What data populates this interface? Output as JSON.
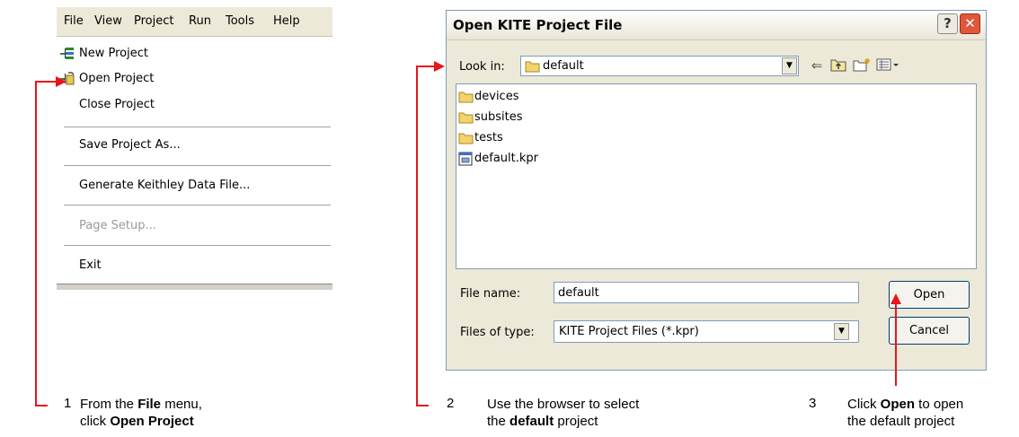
{
  "menu": {
    "menubar": [
      "File",
      "View",
      "Project",
      "Run",
      "Tools",
      "Help"
    ],
    "items": [
      {
        "label": "New Project",
        "icon": "new-project-icon"
      },
      {
        "label": "Open Project",
        "icon": "open-project-icon"
      },
      {
        "label": "Close Project"
      },
      {
        "label": "Save Project As..."
      },
      {
        "label": "Generate Keithley Data File..."
      },
      {
        "label": "Page Setup...",
        "disabled": true
      },
      {
        "label": "Exit"
      }
    ]
  },
  "dialog": {
    "title": "Open KITE Project File",
    "help_button": "?",
    "close_button": "✕",
    "look_in_label": "Look in:",
    "look_in_value": "default",
    "files": [
      {
        "name": "devices",
        "icon": "folder-icon"
      },
      {
        "name": "subsites",
        "icon": "folder-icon"
      },
      {
        "name": "tests",
        "icon": "folder-icon"
      },
      {
        "name": "default.kpr",
        "icon": "kpr-file-icon"
      }
    ],
    "file_name_label": "File name:",
    "file_name_value": "default",
    "files_of_type_label": "Files of type:",
    "files_of_type_value": "KITE Project Files (*.kpr)",
    "open_button": "Open",
    "cancel_button": "Cancel"
  },
  "steps": [
    {
      "number": "1",
      "line1_pre": "From the ",
      "line1_bold": "File",
      "line1_post": " menu,",
      "line2_pre": "click ",
      "line2_bold": "Open Project",
      "line2_post": ""
    },
    {
      "number": "2",
      "line1_pre": "Use the browser to select",
      "line1_bold": "",
      "line1_post": "",
      "line2_pre": "the ",
      "line2_bold": "default",
      "line2_post": " project"
    },
    {
      "number": "3",
      "line1_pre": "Click ",
      "line1_bold": "Open",
      "line1_post": " to open",
      "line2_pre": "the default project",
      "line2_bold": "",
      "line2_post": ""
    }
  ],
  "colors": {
    "arrow": "#e8151b",
    "dialog_bg": "#ece9d8",
    "close_button": "#e0573b"
  }
}
